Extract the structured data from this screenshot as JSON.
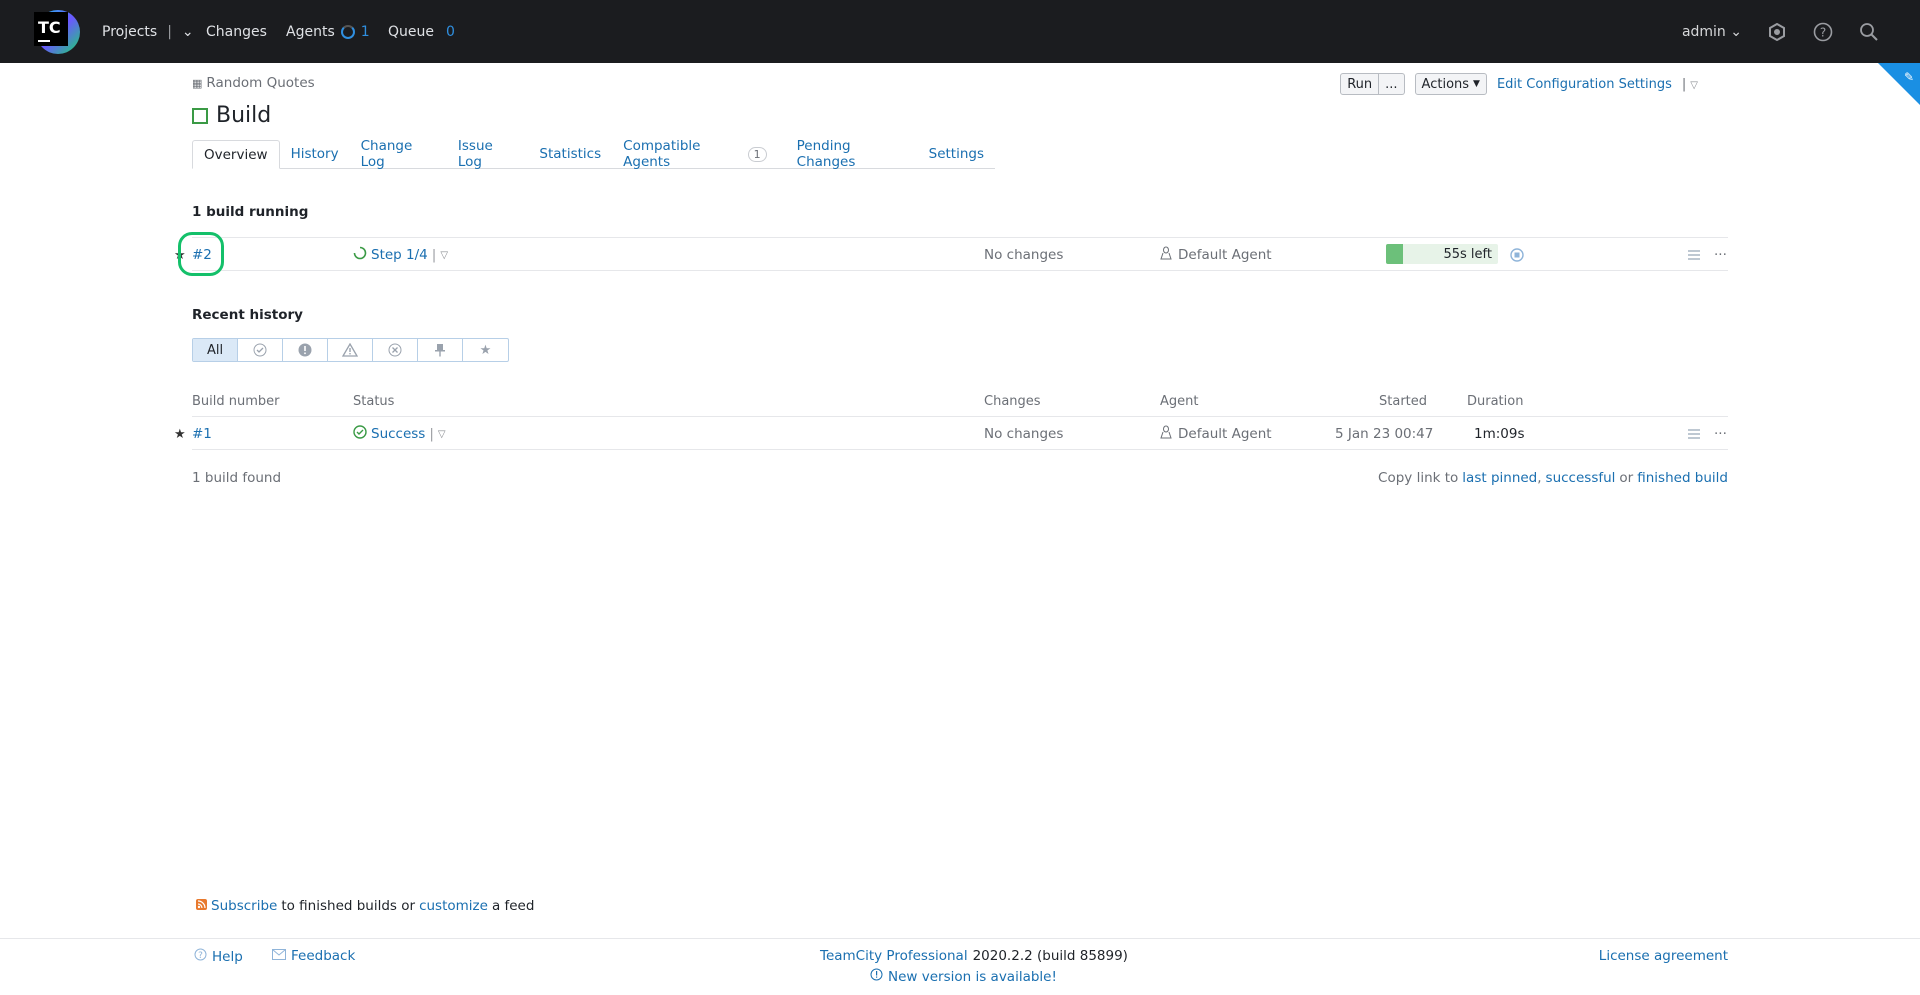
{
  "header": {
    "logo_text": "TC",
    "nav": {
      "projects": "Projects",
      "changes": "Changes",
      "agents": "Agents",
      "agents_count": "1",
      "queue": "Queue",
      "queue_count": "0"
    },
    "user": "admin",
    "icons": [
      "settings-icon",
      "help-icon",
      "search-icon"
    ]
  },
  "breadcrumb": {
    "project": "Random Quotes"
  },
  "page": {
    "title": "Build"
  },
  "actions": {
    "run": "Run",
    "run_more": "...",
    "actions": "Actions",
    "edit_settings": "Edit Configuration Settings"
  },
  "tabs": [
    {
      "label": "Overview"
    },
    {
      "label": "History"
    },
    {
      "label": "Change Log"
    },
    {
      "label": "Issue Log"
    },
    {
      "label": "Statistics"
    },
    {
      "label": "Compatible Agents",
      "badge": "1"
    },
    {
      "label": "Pending Changes"
    },
    {
      "label": "Settings"
    }
  ],
  "running": {
    "heading": "1 build running",
    "build": {
      "number": "#2",
      "status": "Step 1/4",
      "changes": "No changes",
      "agent": "Default Agent",
      "time_left": "55s left",
      "progress": 0.15
    }
  },
  "history": {
    "heading": "Recent history",
    "filter_all": "All",
    "columns": {
      "build_number": "Build number",
      "status": "Status",
      "changes": "Changes",
      "agent": "Agent",
      "started": "Started",
      "duration": "Duration"
    },
    "rows": [
      {
        "number": "#1",
        "status": "Success",
        "changes": "No changes",
        "agent": "Default Agent",
        "started": "5 Jan 23 00:47",
        "duration": "1m:09s"
      }
    ],
    "found": "1 build found",
    "copy_link": {
      "prefix": "Copy link to",
      "last_pinned": "last pinned",
      "comma": ",",
      "successful": "successful",
      "or": "or",
      "finished": "finished build"
    }
  },
  "feed": {
    "subscribe": "Subscribe",
    "middle": "to finished builds or",
    "customize": "customize",
    "end": "a feed"
  },
  "footer": {
    "help": "Help",
    "feedback": "Feedback",
    "product": "TeamCity Professional",
    "version": "2020.2.2 (build 85899)",
    "new_version": "New version is available!",
    "license": "License agreement"
  },
  "colors": {
    "header_bg": "#1b1c1f",
    "link": "#1a6fb0",
    "success": "#3a9a45",
    "highlight": "#14c06a"
  }
}
